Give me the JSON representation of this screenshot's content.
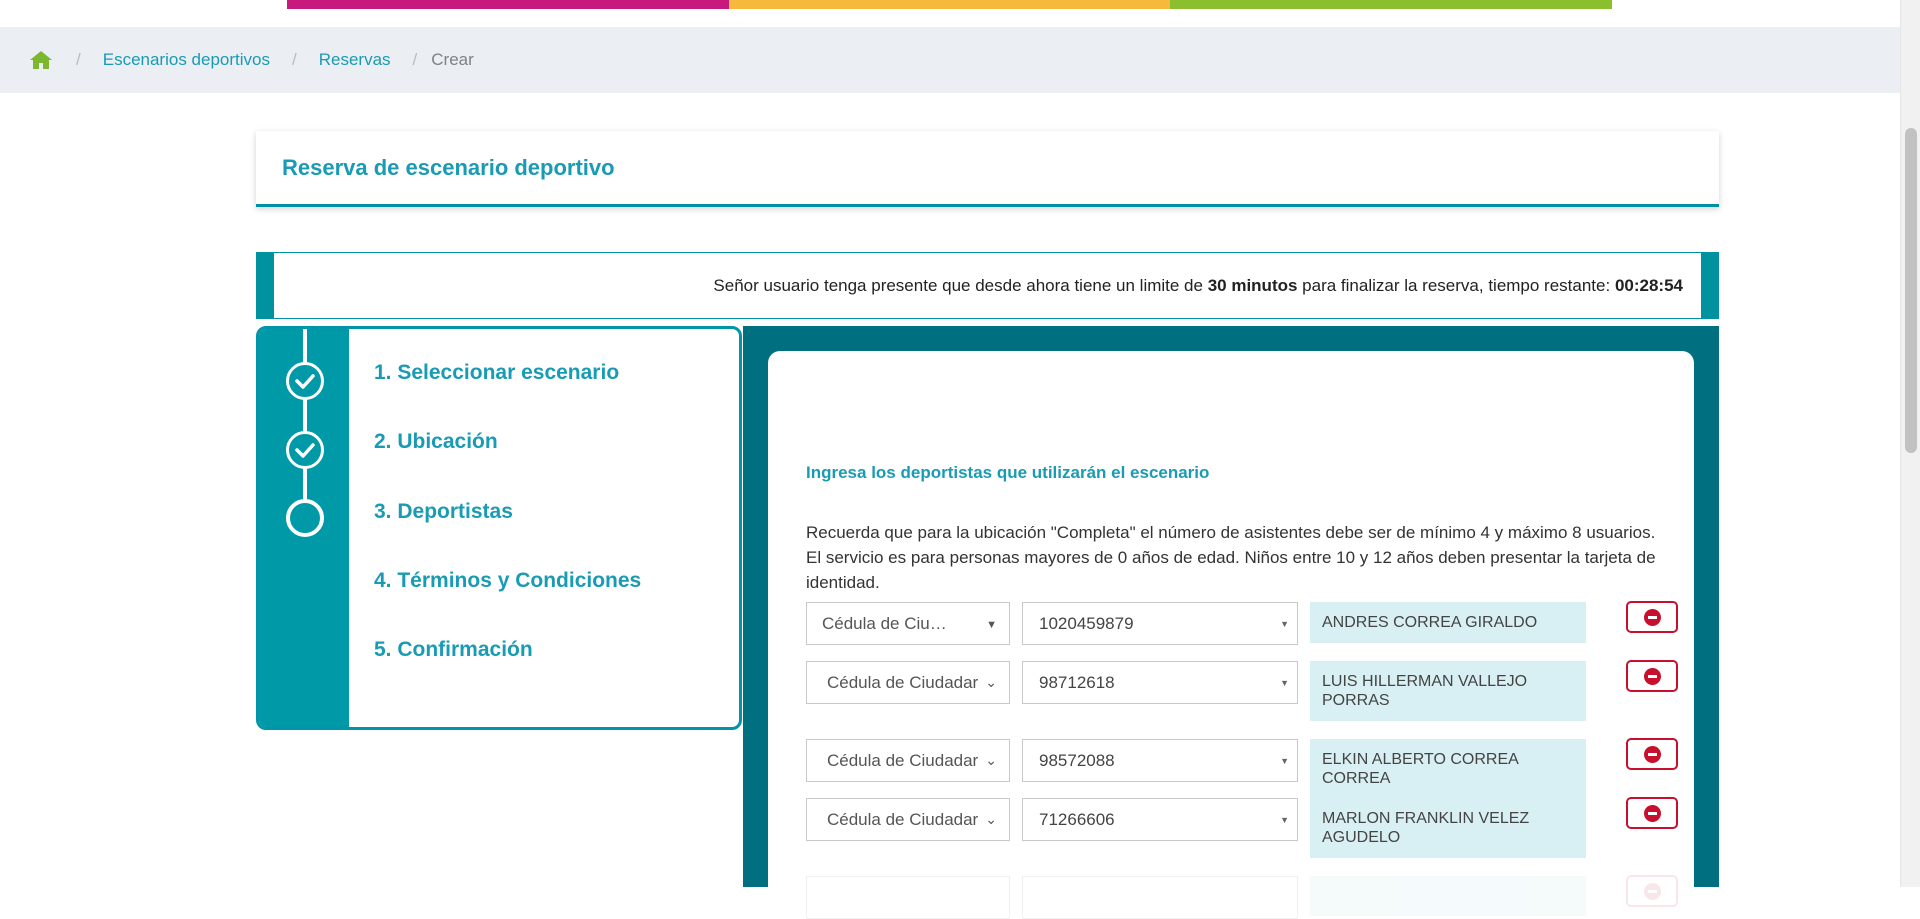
{
  "colors": {
    "stripe": [
      "#c8197d",
      "#f6b93b",
      "#8cbf2e"
    ],
    "accent": "#1a9bb4",
    "teal_dark": "#006f80",
    "remove_red": "#c8102e",
    "home_icon": "#7cb82f"
  },
  "breadcrumb": {
    "home_icon": "home-icon",
    "items": [
      "Escenarios deportivos",
      "Reservas"
    ],
    "current": "Crear"
  },
  "header": {
    "title": "Reserva de escenario deportivo"
  },
  "timer": {
    "prefix": "Señor usuario tenga presente que desde ahora tiene un limite de ",
    "limit": "30 minutos",
    "middle": " para finalizar la reserva, tiempo restante: ",
    "remaining": "00:28:54"
  },
  "steps": [
    {
      "label": "1. Seleccionar escenario",
      "state": "done"
    },
    {
      "label": "2. Ubicación",
      "state": "done"
    },
    {
      "label": "3. Deportistas",
      "state": "current"
    },
    {
      "label": "4. Términos y Condiciones",
      "state": "pending"
    },
    {
      "label": "5. Confirmación",
      "state": "pending"
    }
  ],
  "form": {
    "subtitle": "Ingresa los deportistas que utilizarán el escenario",
    "note": "Recuerda que para la ubicación \"Completa\" el número de asistentes debe ser de mínimo 4 y máximo 8 usuarios. El servicio es para personas mayores de 0 años de edad. Niños entre 10 y 12 años deben presentar la tarjeta de identidad.",
    "athletes": [
      {
        "doc_type": "Cédula de Ciu…",
        "doc_number": "1020459879",
        "name": "ANDRES CORREA GIRALDO"
      },
      {
        "doc_type": "Cédula de Ciudadar",
        "doc_number": "98712618",
        "name": "LUIS HILLERMAN VALLEJO PORRAS"
      },
      {
        "doc_type": "Cédula de Ciudadar",
        "doc_number": "98572088",
        "name": "ELKIN ALBERTO CORREA CORREA"
      },
      {
        "doc_type": "Cédula de Ciudadar",
        "doc_number": "71266606",
        "name": "MARLON FRANKLIN VELEZ AGUDELO"
      }
    ]
  }
}
